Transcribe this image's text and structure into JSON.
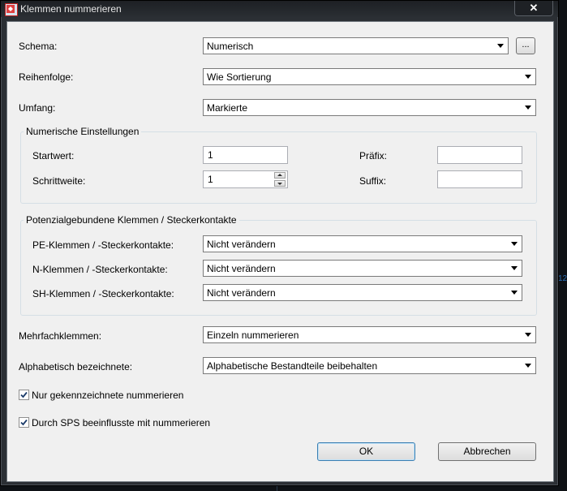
{
  "window": {
    "title": "Klemmen nummerieren",
    "close_glyph": "✕"
  },
  "fields": {
    "schema": {
      "label": "Schema:",
      "value": "Numerisch",
      "more_label": "..."
    },
    "reihenfolge": {
      "label": "Reihenfolge:",
      "value": "Wie Sortierung"
    },
    "umfang": {
      "label": "Umfang:",
      "value": "Markierte"
    }
  },
  "numeric_settings": {
    "title": "Numerische Einstellungen",
    "startwert": {
      "label": "Startwert:",
      "value": "1"
    },
    "schrittweite": {
      "label": "Schrittweite:",
      "value": "1"
    },
    "praefix": {
      "label": "Präfix:",
      "value": ""
    },
    "suffix": {
      "label": "Suffix:",
      "value": ""
    }
  },
  "potential": {
    "title": "Potenzialgebundene Klemmen / Steckerkontakte",
    "pe": {
      "label": "PE-Klemmen / -Steckerkontakte:",
      "value": "Nicht verändern"
    },
    "n": {
      "label": "N-Klemmen / -Steckerkontakte:",
      "value": "Nicht verändern"
    },
    "sh": {
      "label": "SH-Klemmen / -Steckerkontakte:",
      "value": "Nicht verändern"
    }
  },
  "mehrfach": {
    "label": "Mehrfachklemmen:",
    "value": "Einzeln nummerieren"
  },
  "alphabetisch": {
    "label": "Alphabetisch bezeichnete:",
    "value": "Alphabetische Bestandteile beibehalten"
  },
  "checkboxes": {
    "nur_gekennzeichnete": {
      "label": "Nur gekennzeichnete nummerieren",
      "checked": true
    },
    "durch_sps": {
      "label": "Durch SPS beeinflusste mit nummerieren",
      "checked": true
    }
  },
  "buttons": {
    "ok": "OK",
    "cancel": "Abbrechen"
  },
  "background": {
    "side_text": "12"
  },
  "colors": {
    "window_bg": "#f0f0f0",
    "frame": "#2b2f34",
    "accent": "#3c7fb1"
  }
}
